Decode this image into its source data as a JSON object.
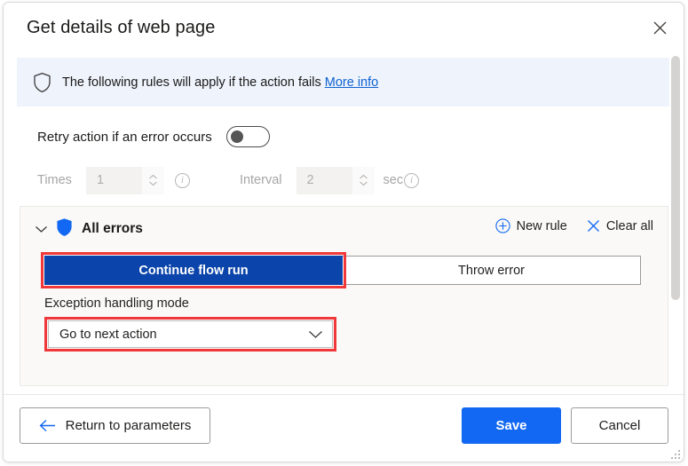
{
  "window": {
    "title": "Get details of web page",
    "close_icon": "close-icon"
  },
  "banner": {
    "shield_icon": "shield-outline-icon",
    "text": "The following rules will apply if the action fails",
    "link_label": "More info"
  },
  "retry": {
    "label": "Retry action if an error occurs",
    "toggle_state": "off"
  },
  "fields": {
    "times_label": "Times",
    "times_value": "1",
    "times_info_icon": "info-icon",
    "interval_label": "Interval",
    "interval_value": "2",
    "interval_unit": "sec",
    "interval_info_icon": "info-icon",
    "spin_up_icon": "chevron-up-icon",
    "spin_down_icon": "chevron-down-icon"
  },
  "errors_card": {
    "collapse_icon": "chevron-down-icon",
    "shield_icon": "shield-filled-icon",
    "title": "All errors",
    "new_rule_icon": "plus-circle-icon",
    "new_rule_label": "New rule",
    "clear_all_icon": "close-icon",
    "clear_all_label": "Clear all",
    "segments": [
      {
        "label": "Continue flow run",
        "selected": true
      },
      {
        "label": "Throw error",
        "selected": false
      }
    ],
    "exception_label": "Exception handling mode",
    "exception_value": "Go to next action",
    "dropdown_icon": "chevron-down-icon"
  },
  "scrollbar": {
    "orientation": "vertical"
  },
  "footer": {
    "return_icon": "arrow-left-icon",
    "return_label": "Return to parameters",
    "save_label": "Save",
    "cancel_label": "Cancel",
    "resize_grip_icon": "resize-grip-icon"
  },
  "colors": {
    "accent_blue": "#1268f2",
    "selected_segment_blue": "#0b44aa",
    "annotation_red": "#f0373a",
    "banner_bg": "#eef3fc",
    "card_bg": "#faf9f8"
  }
}
